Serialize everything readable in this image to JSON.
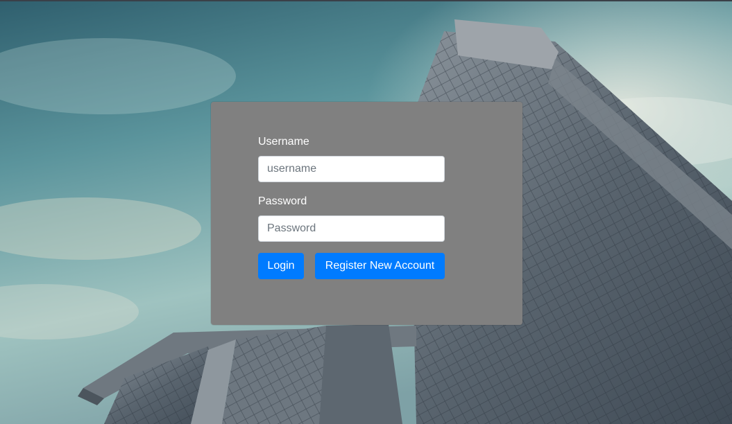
{
  "background": {
    "sky_top": "#4f7f8a",
    "sky_bottom": "#c9d9d4",
    "building": "#5b6670"
  },
  "login_form": {
    "username_label": "Username",
    "username_placeholder": "username",
    "username_value": "",
    "password_label": "Password",
    "password_placeholder": "Password",
    "password_value": "",
    "login_button": "Login",
    "register_button": "Register New Account"
  },
  "colors": {
    "panel": "#808080",
    "primary_button": "#007bff"
  }
}
